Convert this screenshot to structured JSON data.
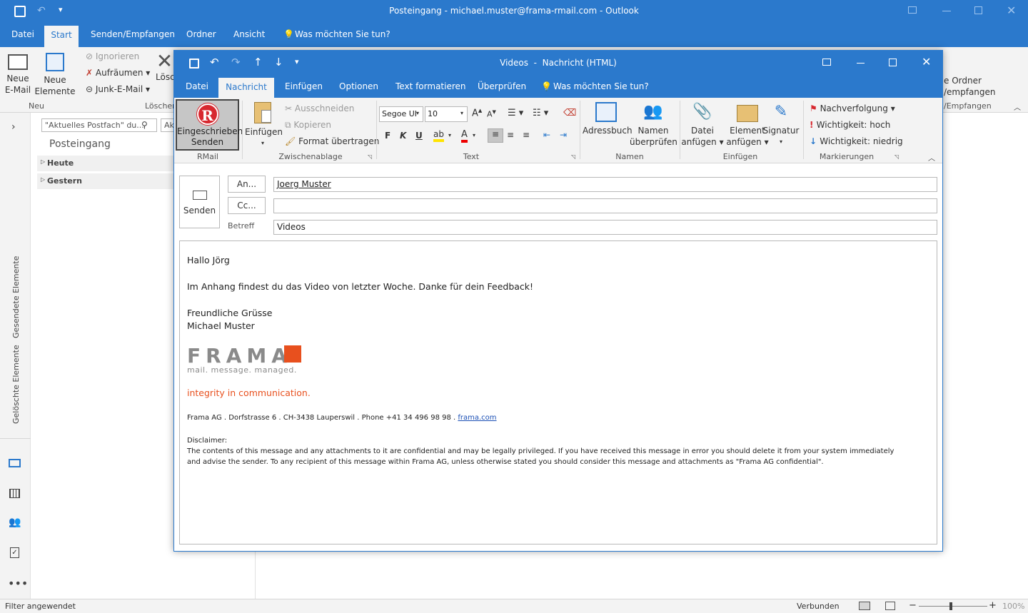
{
  "outlook": {
    "window_title": "Posteingang - michael.muster@frama-rmail.com  -  Outlook",
    "tabs": [
      "Datei",
      "Start",
      "Senden/Empfangen",
      "Ordner",
      "Ansicht",
      "Was möchten Sie tun?"
    ],
    "ribbon": {
      "neue_email": "Neue\nE-Mail",
      "neue_elemente": "Neue\nElemente",
      "ignorieren": "Ignorieren",
      "aufraeumen": "Aufräumen",
      "junk": "Junk-E-Mail",
      "loeschen": "Lösc",
      "group_neu": "Neu",
      "group_loeschen": "Löschen",
      "ordner_right": "e Ordner",
      "empfangen_right": "/empfangen",
      "group_right": "/Empfangen"
    },
    "nav": {
      "gesendete": "Gesendete Elemente",
      "geloeschte": "Gelöschte Elemente"
    },
    "list": {
      "search_placeholder": "\"Aktuelles Postfach\" du...",
      "scope": "Ak",
      "folder_title": "Posteingang",
      "groups": [
        "Heute",
        "Gestern"
      ]
    },
    "status": {
      "filter": "Filter angewendet",
      "connection": "Verbunden",
      "zoom": "100%"
    }
  },
  "compose": {
    "title": "Videos  -  Nachricht (HTML)",
    "tabs": [
      "Datei",
      "Nachricht",
      "Einfügen",
      "Optionen",
      "Text formatieren",
      "Überprüfen",
      "Was möchten Sie tun?"
    ],
    "ribbon": {
      "rmail_button": "Eingeschrieben\nSenden",
      "group_rmail": "RMail",
      "einfuegen": "Einfügen",
      "ausschneiden": "Ausschneiden",
      "kopieren": "Kopieren",
      "format": "Format übertragen",
      "group_zwischenablage": "Zwischenablage",
      "font": "Segoe UI",
      "size": "10",
      "group_text": "Text",
      "bold": "F",
      "italic": "K",
      "underline": "U",
      "adressbuch": "Adressbuch",
      "namen": "Namen\nüberprüfen",
      "group_namen": "Namen",
      "datei": "Datei\nanfügen",
      "element": "Element\nanfügen",
      "signatur": "Signatur",
      "group_einfuegen": "Einfügen",
      "nachverfolgung": "Nachverfolgung",
      "hoch": "Wichtigkeit: hoch",
      "niedrig": "Wichtigkeit: niedrig",
      "group_markierungen": "Markierungen"
    },
    "header": {
      "send": "Senden",
      "to_button": "An...",
      "cc_button": "Cc...",
      "subject_label": "Betreff",
      "to_value": "Joerg Muster",
      "cc_value": "",
      "subject_value": "Videos"
    },
    "body": {
      "greeting": "Hallo Jörg",
      "text": "Im Anhang findest du das Video von letzter Woche. Danke für dein Feedback!",
      "closing": "Freundliche Grüsse",
      "name": "Michael Muster",
      "logo_word": "FRAMA",
      "logo_tagline": "mail. message. managed.",
      "slogan": "integrity in communication.",
      "address": "Frama AG . Dorfstrasse 6 . CH-3438 Lauperswil . Phone +41 34 496 98 98 . ",
      "link": "frama.com",
      "disclaimer_label": "Disclaimer:",
      "disclaimer": "The contents of this message and any attachments to it are confidential and may be legally privileged. If you have received this message in error you should delete it from your system immediately and advise the sender. To any recipient of this message within Frama AG, unless otherwise stated you should consider this message and attachments as \"Frama AG confidential\"."
    }
  },
  "colors": {
    "accent": "#2b79cc",
    "slogan": "#e8501e",
    "logo_gray": "#8a8a8a",
    "rmail_red": "#d7282f"
  }
}
